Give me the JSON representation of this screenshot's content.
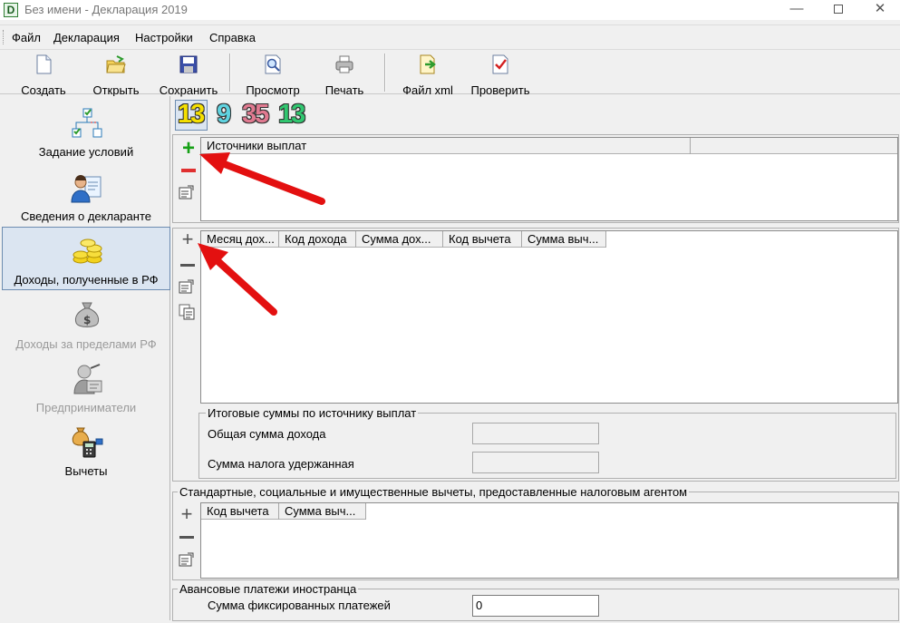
{
  "window": {
    "title": "Без имени - Декларация 2019",
    "app_icon_letter": "D"
  },
  "menu": [
    "Файл",
    "Декларация",
    "Настройки",
    "Справка"
  ],
  "toolbar": {
    "create": "Создать",
    "open": "Открыть",
    "save": "Сохранить",
    "preview": "Просмотр",
    "print": "Печать",
    "xml": "Файл xml",
    "check": "Проверить"
  },
  "sidebar": {
    "items": [
      {
        "label": "Задание условий",
        "icon": "conditions-icon",
        "state": "normal"
      },
      {
        "label": "Сведения о декларанте",
        "icon": "declarant-icon",
        "state": "normal"
      },
      {
        "label": "Доходы, полученные в РФ",
        "icon": "coins-icon",
        "state": "active"
      },
      {
        "label": "Доходы за пределами РФ",
        "icon": "money-bag-icon",
        "state": "disabled"
      },
      {
        "label": "Предприниматели",
        "icon": "entrepreneur-icon",
        "state": "disabled"
      },
      {
        "label": "Вычеты",
        "icon": "deductions-icon",
        "state": "normal"
      }
    ]
  },
  "tax_rates": [
    "13",
    "9",
    "35",
    "13"
  ],
  "rate_colors": [
    "#f5e000",
    "#5fd3e0",
    "#e07a90",
    "#31c770"
  ],
  "sources": {
    "columns": [
      "Источники выплат"
    ]
  },
  "income": {
    "columns": [
      "Месяц дох...",
      "Код дохода",
      "Сумма дох...",
      "Код вычета",
      "Сумма выч..."
    ],
    "totals_title": "Итоговые суммы по источнику выплат",
    "total_income_label": "Общая сумма дохода",
    "total_tax_label": "Сумма налога удержанная"
  },
  "deductions": {
    "title": "Стандартные, социальные и имущественные вычеты, предоставленные налоговым агентом",
    "columns": [
      "Код вычета",
      "Сумма выч..."
    ]
  },
  "advance": {
    "title": "Авансовые платежи иностранца",
    "fixed_label": "Сумма фиксированных платежей",
    "fixed_value": "0"
  }
}
